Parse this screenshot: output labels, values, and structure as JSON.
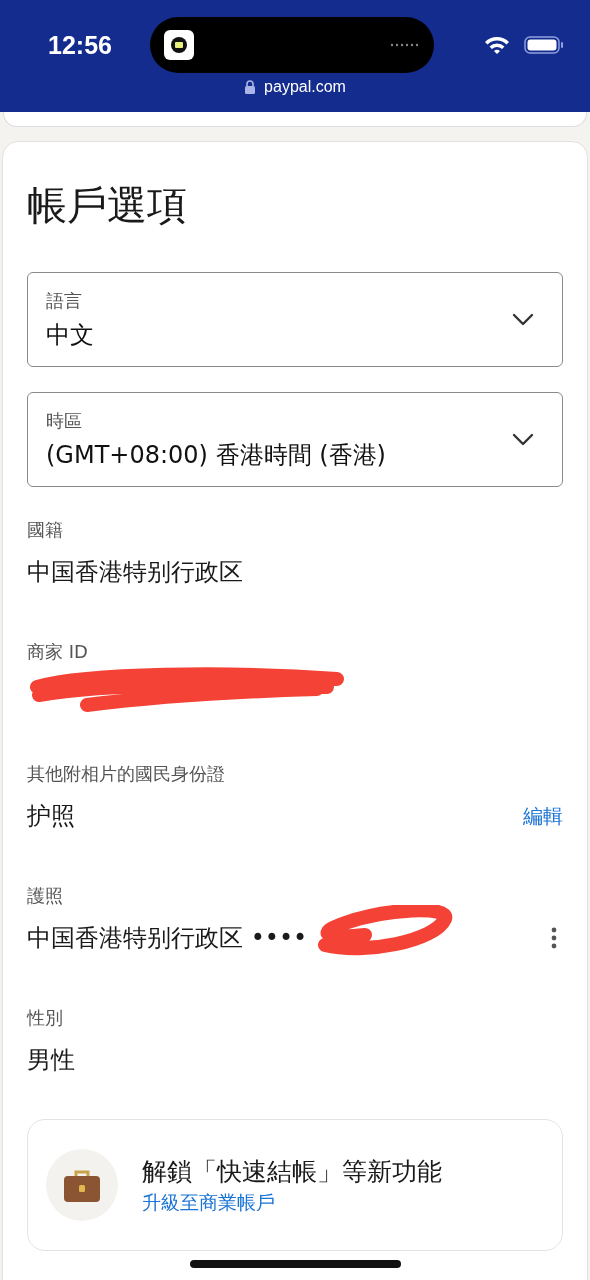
{
  "status_bar": {
    "time": "12:56",
    "url": "paypal.com"
  },
  "title": "帳戶選項",
  "selects": [
    {
      "label": "語言",
      "value": "中文"
    },
    {
      "label": "時區",
      "value": "(GMT+08:00) 香港時間 (香港)"
    }
  ],
  "details": [
    {
      "kind": "plain",
      "label": "國籍",
      "value": "中国香港特别行政区"
    },
    {
      "kind": "redacted",
      "label": "商家 ID"
    },
    {
      "kind": "edit",
      "label": "其他附相片的國民身份證",
      "value": "护照",
      "action": "編輯"
    },
    {
      "kind": "menu",
      "label": "護照",
      "value": "中国香港特别行政区 ••••",
      "redacted": true
    },
    {
      "kind": "plain",
      "label": "性別",
      "value": "男性"
    }
  ],
  "promo": {
    "title": "解鎖「快速結帳」等新功能",
    "link": "升級至商業帳戶"
  }
}
